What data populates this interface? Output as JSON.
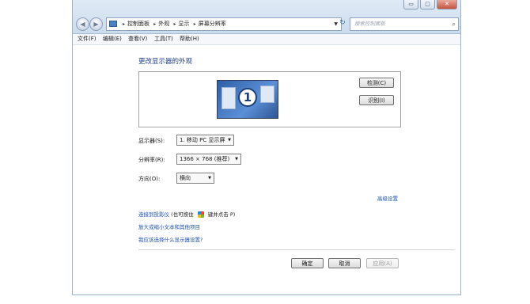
{
  "window_controls": {
    "minimize": "▭",
    "maximize": "▢",
    "close": "✕"
  },
  "nav": {
    "back_icon": "◀",
    "forward_icon": "▶"
  },
  "address_bar": {
    "crumbs": [
      "控制面板",
      "外观",
      "显示",
      "屏幕分辨率"
    ],
    "dropdown_icon": "▼",
    "refresh_icon": "↻"
  },
  "search": {
    "placeholder": "搜索控制面板",
    "icon": "⌕"
  },
  "menubar": {
    "items": [
      "文件(F)",
      "编辑(E)",
      "查看(V)",
      "工具(T)",
      "帮助(H)"
    ]
  },
  "main": {
    "heading": "更改显示器的外观",
    "monitor_number": "1",
    "detect_button": "检测(C)",
    "identify_button": "识别(I)",
    "display_label": "显示器(S):",
    "display_value": "1. 移动 PC 显示屏",
    "resolution_label": "分辨率(R):",
    "resolution_value": "1366 × 768 (推荐)",
    "orientation_label": "方向(O):",
    "orientation_value": "横向",
    "advanced_link": "高级设置",
    "projector_link": "连接到投影仪",
    "projector_hint_prefix": "(也可按住",
    "projector_hint_suffix": "键并点击 P)",
    "text_size_link": "放大或缩小文本和其他项目",
    "help_link": "我应该选择什么显示器设置?"
  },
  "footer": {
    "ok_button": "确定",
    "cancel_button": "取消",
    "apply_button": "应用(A)"
  }
}
